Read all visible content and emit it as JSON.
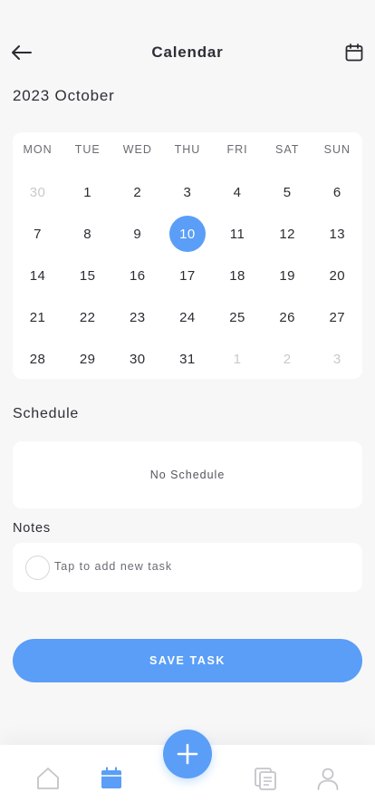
{
  "header": {
    "title": "Calendar",
    "back_icon": "arrow-left-icon",
    "calendar_icon": "calendar-icon"
  },
  "month_label": "2023 October",
  "calendar": {
    "weekdays": [
      "MON",
      "TUE",
      "WED",
      "THU",
      "FRI",
      "SAT",
      "SUN"
    ],
    "selected_day": "10",
    "weeks": [
      [
        {
          "label": "30",
          "muted": true
        },
        {
          "label": "1"
        },
        {
          "label": "2"
        },
        {
          "label": "3"
        },
        {
          "label": "4"
        },
        {
          "label": "5"
        },
        {
          "label": "6"
        }
      ],
      [
        {
          "label": "7"
        },
        {
          "label": "8"
        },
        {
          "label": "9"
        },
        {
          "label": "10",
          "selected": true
        },
        {
          "label": "11"
        },
        {
          "label": "12"
        },
        {
          "label": "13"
        }
      ],
      [
        {
          "label": "14"
        },
        {
          "label": "15"
        },
        {
          "label": "16"
        },
        {
          "label": "17"
        },
        {
          "label": "18"
        },
        {
          "label": "19"
        },
        {
          "label": "20"
        }
      ],
      [
        {
          "label": "21"
        },
        {
          "label": "22"
        },
        {
          "label": "23"
        },
        {
          "label": "24"
        },
        {
          "label": "25"
        },
        {
          "label": "26"
        },
        {
          "label": "27"
        }
      ],
      [
        {
          "label": "28"
        },
        {
          "label": "29"
        },
        {
          "label": "30"
        },
        {
          "label": "31"
        },
        {
          "label": "1",
          "muted": true
        },
        {
          "label": "2",
          "muted": true
        },
        {
          "label": "3",
          "muted": true
        }
      ]
    ]
  },
  "schedule": {
    "label": "Schedule",
    "empty_text": "No Schedule"
  },
  "notes": {
    "label": "Notes",
    "placeholder": "Tap to add new task"
  },
  "save_button": "SAVE TASK",
  "tabbar": {
    "items": [
      {
        "name": "home-icon",
        "active": false
      },
      {
        "name": "calendar-icon",
        "active": true
      },
      {
        "name": "documents-icon",
        "active": false
      },
      {
        "name": "profile-icon",
        "active": false
      }
    ],
    "fab_icon": "plus-icon"
  },
  "colors": {
    "accent": "#5a9ef7",
    "background": "#f7f7f8",
    "card": "#ffffff",
    "muted_text": "#c9c9ce",
    "inactive_icon": "#c4c4c9"
  }
}
